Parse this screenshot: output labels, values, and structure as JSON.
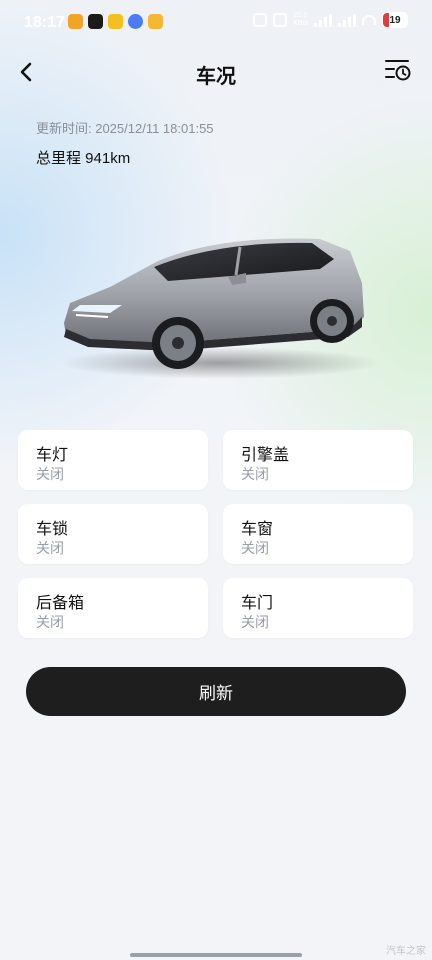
{
  "status_bar": {
    "time": "18:17",
    "network_label_top": "20.0",
    "network_label_bottom": "KB/s",
    "battery_level": "19",
    "notification_icons": [
      {
        "name": "app-orange-icon",
        "color": "#f2a428"
      },
      {
        "name": "mail-icon",
        "color": "#1b1b1b"
      },
      {
        "name": "app-yellow-icon",
        "color": "#f4c01f"
      },
      {
        "name": "browser-icon",
        "color": "#4b7bf5"
      },
      {
        "name": "email-icon",
        "color": "#f6b734"
      }
    ]
  },
  "header": {
    "title": "车况",
    "back_icon": "chevron-left-icon",
    "history_icon": "history-list-icon"
  },
  "info": {
    "update_time": "更新时间: 2025/12/11 18:01:55",
    "mileage": "总里程 941km"
  },
  "status_items": [
    {
      "label": "车灯",
      "value": "关闭"
    },
    {
      "label": "引擎盖",
      "value": "关闭"
    },
    {
      "label": "车锁",
      "value": "关闭"
    },
    {
      "label": "车窗",
      "value": "关闭"
    },
    {
      "label": "后备箱",
      "value": "关闭"
    },
    {
      "label": "车门",
      "value": "关闭"
    }
  ],
  "refresh_label": "刷新",
  "watermark": "汽车之家",
  "colors": {
    "button_bg": "#1e1e1e",
    "card_bg": "#ffffff",
    "muted_text": "#9a9ea6"
  }
}
